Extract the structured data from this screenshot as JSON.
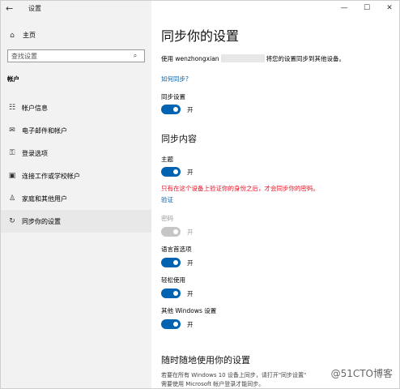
{
  "window": {
    "back_icon": "back-arrow-icon",
    "title": "设置",
    "minimize": "—",
    "maximize": "☐",
    "close": "✕"
  },
  "sidebar": {
    "home_label": "主页",
    "search_placeholder": "查找设置",
    "section": "帐户",
    "items": [
      {
        "label": "帐户信息",
        "icon": "person-card-icon"
      },
      {
        "label": "电子邮件和帐户",
        "icon": "mail-icon"
      },
      {
        "label": "登录选项",
        "icon": "key-icon"
      },
      {
        "label": "连接工作或学校帐户",
        "icon": "briefcase-icon"
      },
      {
        "label": "家庭和其他用户",
        "icon": "user-add-icon"
      },
      {
        "label": "同步你的设置",
        "icon": "sync-icon"
      }
    ]
  },
  "main": {
    "title": "同步你的设置",
    "account_prefix": "使用 wenzhongxian",
    "account_suffix": "将您的设置同步到其他设备。",
    "how_link": "如何同步?",
    "sync_settings_label": "同步设置",
    "sync_settings_state": "开",
    "sync_content_heading": "同步内容",
    "theme_label": "主题",
    "theme_state": "开",
    "verify_message": "只有在这个设备上验证你的身份之后，才会同步你的密码。",
    "verify_link": "验证",
    "password_label": "密码",
    "password_state": "开",
    "language_label": "语言首选项",
    "language_state": "开",
    "ease_label": "轻松使用",
    "ease_state": "开",
    "other_label": "其他 Windows 设置",
    "other_state": "开",
    "anywhere_heading": "随时随地使用你的设置",
    "anywhere_text_1": "若要在所有 Windows 10 设备上同步，请打开\"同步设置\"",
    "anywhere_text_2": "需要使用 Microsoft 帐户登录才能同步。"
  },
  "watermark": "@51CTO博客",
  "colors": {
    "accent": "#0063b1",
    "warning": "#e81123",
    "sidebar_bg": "#f2f2f2"
  }
}
